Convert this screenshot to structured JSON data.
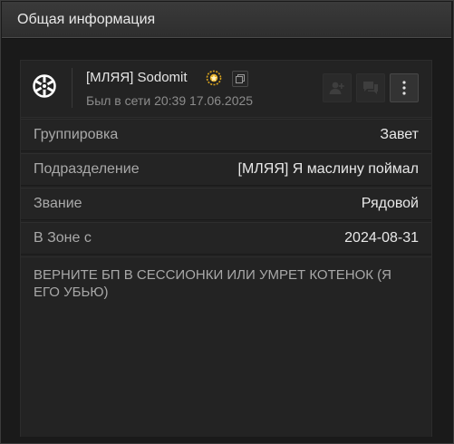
{
  "header": {
    "title": "Общая информация"
  },
  "profile": {
    "name": "[МЛЯЯ] Sodomit",
    "last_seen": "Был в сети 20:39 17.06.2025"
  },
  "info_rows": [
    {
      "label": "Группировка",
      "value": "Завет"
    },
    {
      "label": "Подразделение",
      "value": "[МЛЯЯ] Я маслину поймал"
    },
    {
      "label": "Звание",
      "value": "Рядовой"
    },
    {
      "label": "В Зоне с",
      "value": "2024-08-31"
    }
  ],
  "about": {
    "text": "ВЕРНИТЕ БП В СЕССИОНКИ ИЛИ УМРЕТ КОТЕНОК (Я ЕГО УБЬЮ)"
  },
  "icons": {
    "logo": "faction-emblem-icon",
    "badge": "gold-badge-icon",
    "copy": "copy-icon",
    "add_friend": "add-friend-icon",
    "message": "message-icon",
    "more": "more-vertical-icon"
  },
  "colors": {
    "badge": "#d7a21b",
    "background": "#1b1b1b",
    "panel": "#212121"
  }
}
